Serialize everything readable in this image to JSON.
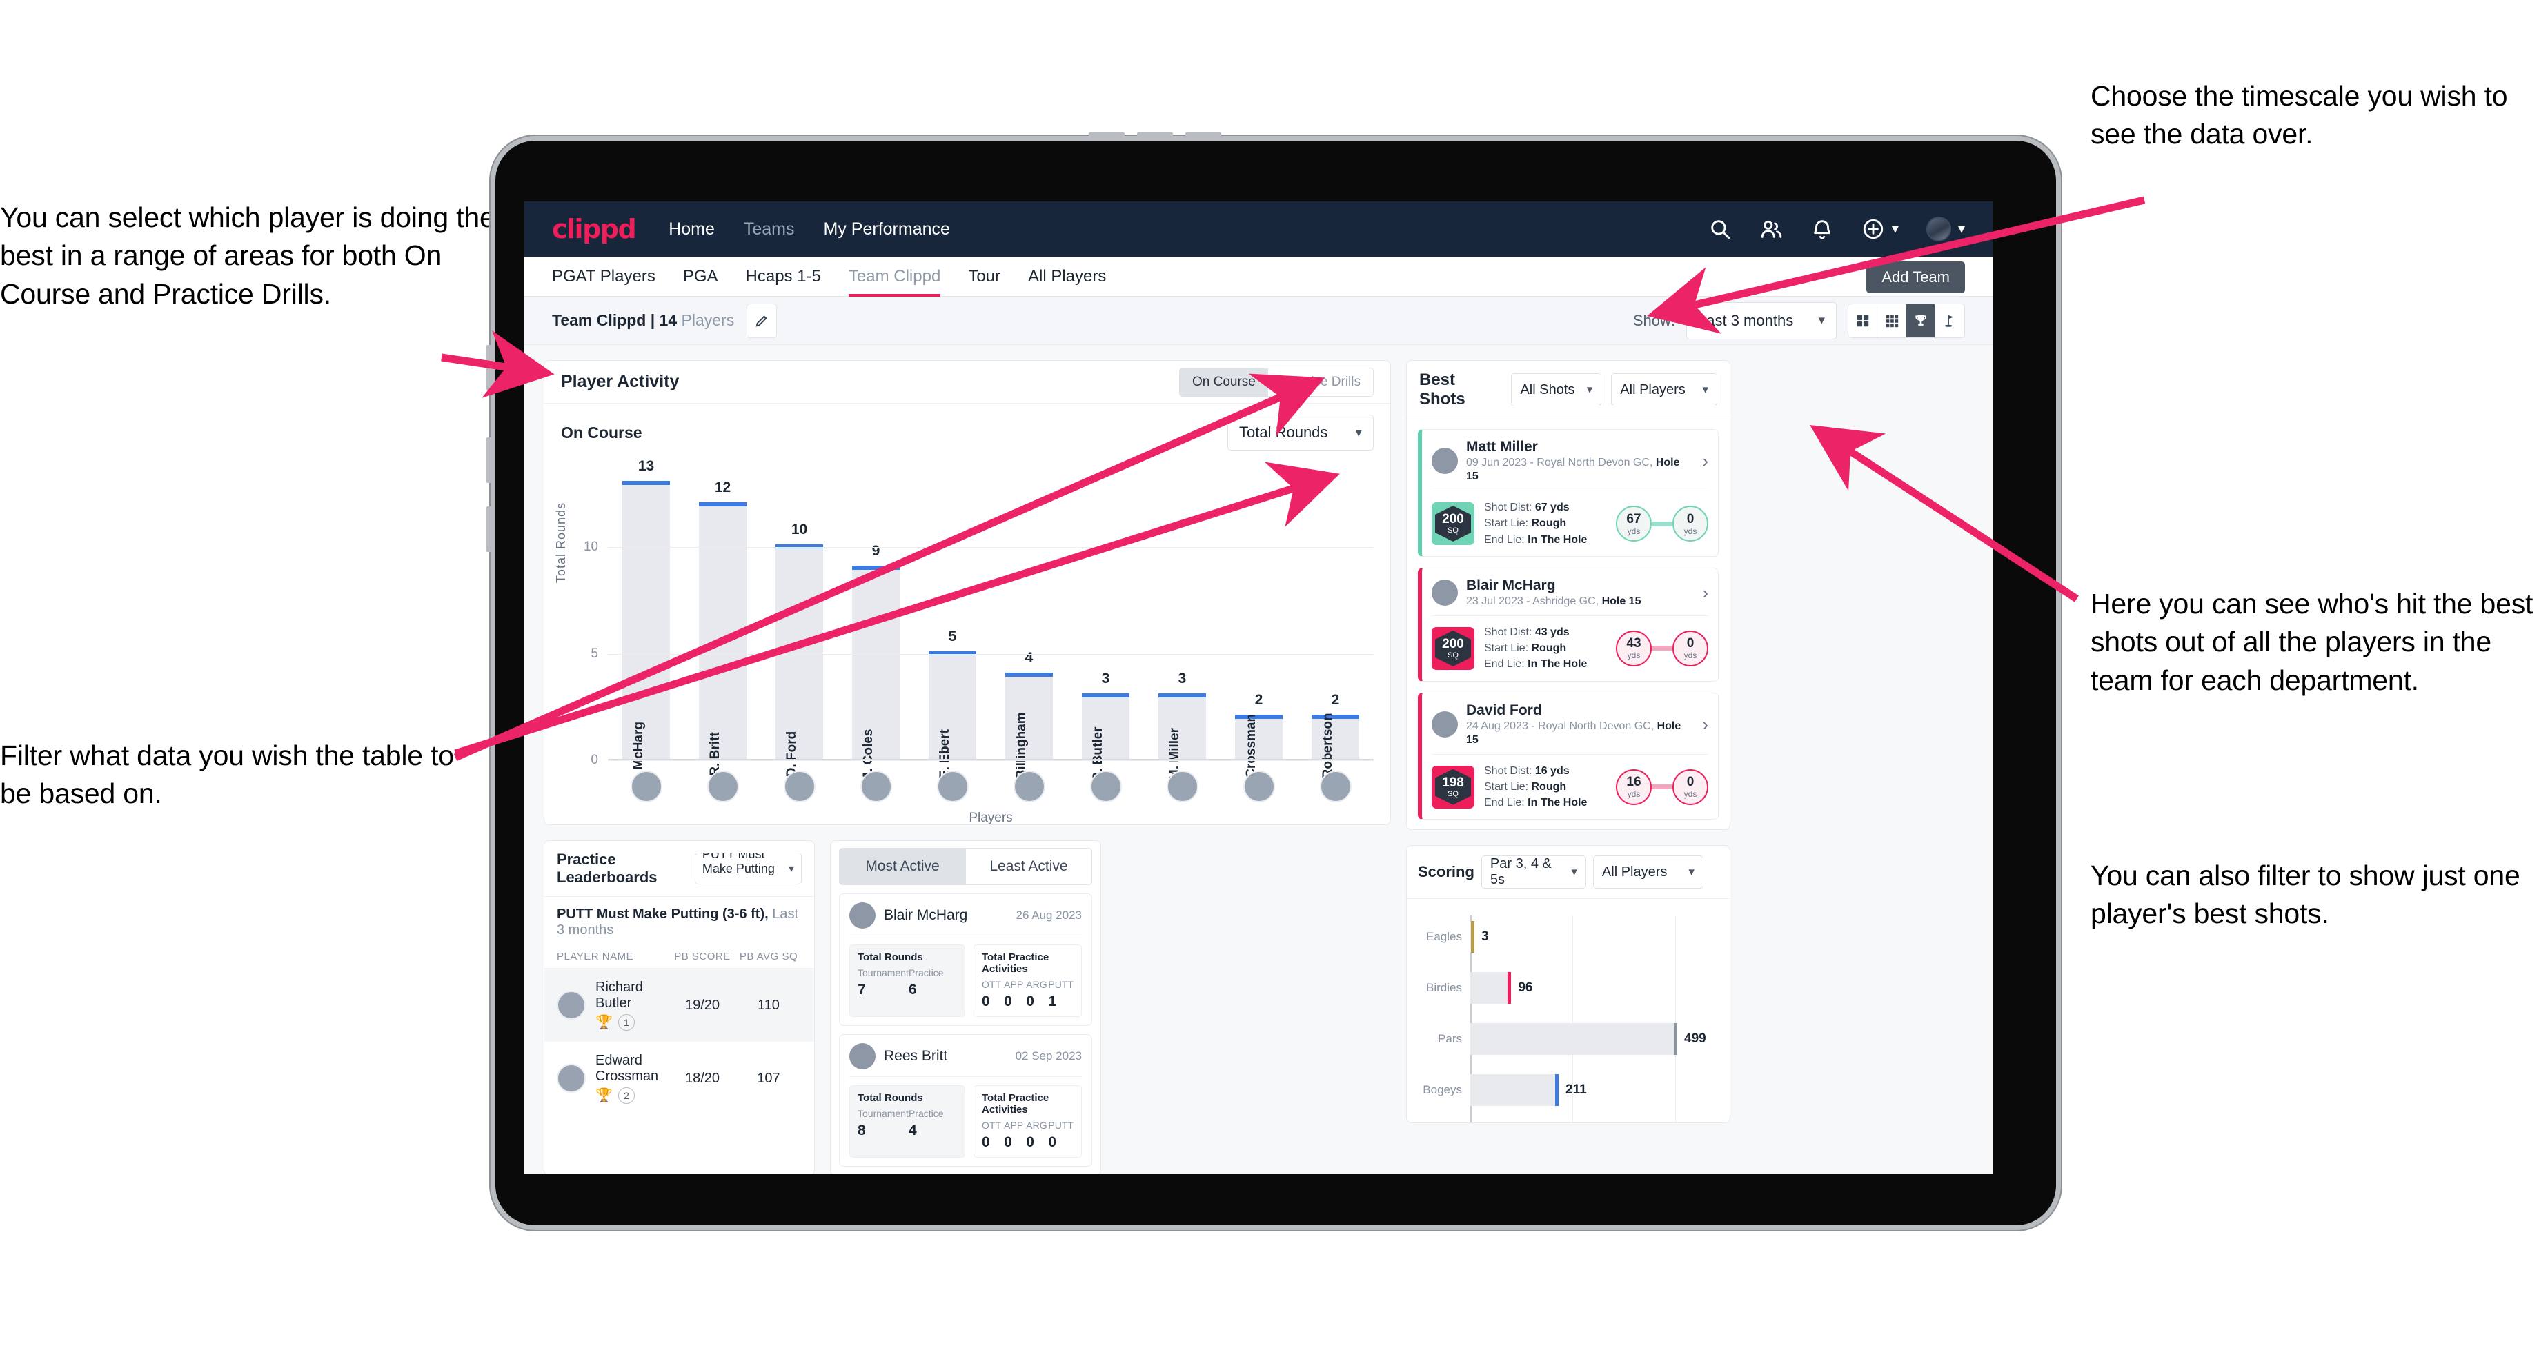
{
  "annotations": {
    "left_top": "You can select which player is doing the best in a range of areas for both On Course and Practice Drills.",
    "left_bottom": "Filter what data you wish the table to be based on.",
    "right_top": "Choose the timescale you wish to see the data over.",
    "right_mid": "Here you can see who's hit the best shots out of all the players in the team for each department.",
    "right_bottom": "You can also filter to show just one player's best shots."
  },
  "topnav": {
    "brand": "clippd",
    "links": [
      {
        "label": "Home",
        "dim": false
      },
      {
        "label": "Teams",
        "dim": true
      },
      {
        "label": "My Performance",
        "dim": false
      }
    ],
    "icons": [
      "search-icon",
      "people-icon",
      "bell-icon",
      "plus-circle-icon",
      "avatar"
    ]
  },
  "tabs": {
    "items": [
      {
        "label": "PGAT Players",
        "active": false
      },
      {
        "label": "PGA",
        "active": false
      },
      {
        "label": "Hcaps 1-5",
        "active": false
      },
      {
        "label": "Team Clippd",
        "active": true
      },
      {
        "label": "Tour",
        "active": false
      },
      {
        "label": "All Players",
        "active": false
      }
    ],
    "add_team": "Add Team"
  },
  "toolbar": {
    "team_name": "Team Clippd",
    "separator": " | ",
    "player_count": "14",
    "players_word": " Players",
    "edit_icon": "pencil-icon",
    "show_label": "Show:",
    "timescale_value": "Last 3 months",
    "view_modes": [
      {
        "name": "grid-2x2-icon",
        "active": false
      },
      {
        "name": "grid-3x3-icon",
        "active": false
      },
      {
        "name": "trophy-icon",
        "active": true
      },
      {
        "name": "golf-flag-icon",
        "active": false
      }
    ]
  },
  "player_activity": {
    "title": "Player Activity",
    "segment": [
      {
        "label": "On Course",
        "active": true
      },
      {
        "label": "Practice Drills",
        "active": false
      }
    ],
    "sub_label": "On Course",
    "metric_value": "Total Rounds"
  },
  "chart_data": [
    {
      "type": "bar",
      "title": "Player Activity",
      "xlabel": "Players",
      "ylabel": "Total Rounds",
      "categories": [
        "B. McHarg",
        "R. Britt",
        "D. Ford",
        "J. Coles",
        "E. Ebert",
        "D. Billingham",
        "R. Butler",
        "M. Miller",
        "E. Crossman",
        "C. Robertson"
      ],
      "values": [
        13,
        12,
        10,
        9,
        5,
        4,
        3,
        3,
        2,
        2
      ],
      "yticks": [
        0,
        5,
        10
      ],
      "ylim": [
        0,
        14
      ],
      "bar_color": "#e7e9ee",
      "cap_color": "#3d7be0",
      "grid": true
    },
    {
      "type": "bar",
      "orientation": "horizontal",
      "title": "Scoring",
      "categories": [
        "Eagles",
        "Birdies",
        "Pars",
        "Bogeys"
      ],
      "values": [
        3,
        96,
        499,
        211
      ],
      "xlim": [
        0,
        600
      ],
      "bar_color": "#e8eaee",
      "end_colors": [
        "#b79a4b",
        "#ed1e5a",
        "#8b939f",
        "#3d7be0"
      ],
      "grid": true
    }
  ],
  "best_shots": {
    "title": "Best Shots",
    "filter_shots": "All Shots",
    "filter_players": "All Players",
    "shots": [
      {
        "player": "Matt Miller",
        "meta_date": "09 Jun 2023 - Royal North Devon GC, ",
        "meta_hole": "Hole 15",
        "sq": "200",
        "sq_unit": "SQ",
        "accent": "teal",
        "shot_dist_label": "Shot Dist: ",
        "shot_dist": "67 yds",
        "start_lie_label": "Start Lie: ",
        "start_lie": "Rough",
        "end_lie_label": "End Lie: ",
        "end_lie": "In The Hole",
        "from_val": "67",
        "from_unit": "yds",
        "to_val": "0",
        "to_unit": "yds"
      },
      {
        "player": "Blair McHarg",
        "meta_date": "23 Jul 2023 - Ashridge GC, ",
        "meta_hole": "Hole 15",
        "sq": "200",
        "sq_unit": "SQ",
        "accent": "pink",
        "shot_dist_label": "Shot Dist: ",
        "shot_dist": "43 yds",
        "start_lie_label": "Start Lie: ",
        "start_lie": "Rough",
        "end_lie_label": "End Lie: ",
        "end_lie": "In The Hole",
        "from_val": "43",
        "from_unit": "yds",
        "to_val": "0",
        "to_unit": "yds"
      },
      {
        "player": "David Ford",
        "meta_date": "24 Aug 2023 - Royal North Devon GC, ",
        "meta_hole": "Hole 15",
        "sq": "198",
        "sq_unit": "SQ",
        "accent": "pink",
        "shot_dist_label": "Shot Dist: ",
        "shot_dist": "16 yds",
        "start_lie_label": "Start Lie: ",
        "start_lie": "Rough",
        "end_lie_label": "End Lie: ",
        "end_lie": "In The Hole",
        "from_val": "16",
        "from_unit": "yds",
        "to_val": "0",
        "to_unit": "yds"
      }
    ]
  },
  "practice_leaderboards": {
    "title": "Practice Leaderboards",
    "drill_select": "PUTT Must Make Putting ...",
    "drill_name": "PUTT Must Make Putting (3-6 ft),",
    "drill_period": " Last 3 months",
    "columns": [
      "PLAYER NAME",
      "PB SCORE",
      "PB AVG SQ"
    ],
    "rows": [
      {
        "name": "Richard Butler",
        "rank": "1",
        "trophy": "gold",
        "pb_score": "19/20",
        "pb_avg_sq": "110"
      },
      {
        "name": "Edward Crossman",
        "rank": "2",
        "trophy": "silver",
        "pb_score": "18/20",
        "pb_avg_sq": "107"
      }
    ]
  },
  "activity": {
    "tabs": [
      {
        "label": "Most Active",
        "active": true
      },
      {
        "label": "Least Active",
        "active": false
      }
    ],
    "cards": [
      {
        "player": "Blair McHarg",
        "date": "26 Aug 2023",
        "rounds_title": "Total Rounds",
        "rounds_keys": [
          "Tournament",
          "Practice"
        ],
        "rounds_values": [
          "7",
          "6"
        ],
        "practice_title": "Total Practice Activities",
        "practice_keys": [
          "OTT",
          "APP",
          "ARG",
          "PUTT"
        ],
        "practice_values": [
          "0",
          "0",
          "0",
          "1"
        ]
      },
      {
        "player": "Rees Britt",
        "date": "02 Sep 2023",
        "rounds_title": "Total Rounds",
        "rounds_keys": [
          "Tournament",
          "Practice"
        ],
        "rounds_values": [
          "8",
          "4"
        ],
        "practice_title": "Total Practice Activities",
        "practice_keys": [
          "OTT",
          "APP",
          "ARG",
          "PUTT"
        ],
        "practice_values": [
          "0",
          "0",
          "0",
          "0"
        ]
      }
    ]
  },
  "scoring": {
    "title": "Scoring",
    "filter_par": "Par 3, 4 & 5s",
    "filter_players": "All Players"
  },
  "colors": {
    "brand_pink": "#ed1e5a",
    "nav_dark": "#17263b",
    "bar_cap_blue": "#3d7be0",
    "teal": "#6fd4b5",
    "gold": "#b79a4b"
  }
}
